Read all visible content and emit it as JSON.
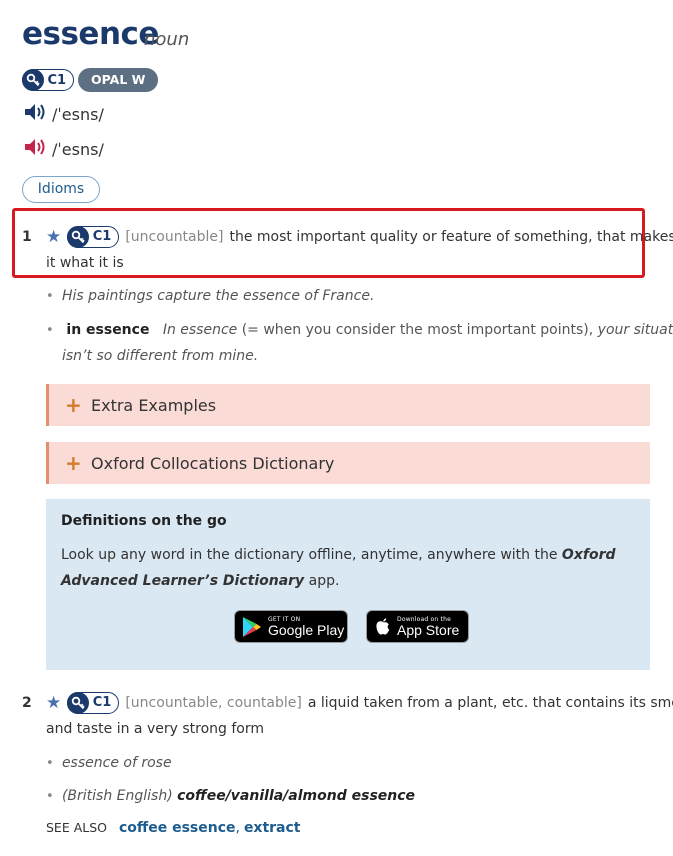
{
  "entry": {
    "headword": "essence",
    "pos": "noun",
    "level": "C1",
    "opal": "OPAL W",
    "pron_uk": "/ˈesns/",
    "pron_us": "/ˈesns/",
    "idioms_label": "Idioms"
  },
  "senses": [
    {
      "number": "1",
      "level": "C1",
      "grammar": "[uncountable]",
      "definition_line1": "the most important quality or feature of something, that makes",
      "definition_line2": "it what it is",
      "examples": [
        {
          "text": "His paintings capture the essence of France."
        }
      ],
      "idiom_example": {
        "phrase": "in essence",
        "lead": "In essence",
        "gloss": "(= when you consider the most important points),",
        "continuation": "your situation",
        "line2": "isn’t so different from mine."
      }
    },
    {
      "number": "2",
      "level": "C1",
      "grammar": "[uncountable, countable]",
      "definition_line1": "a liquid taken from a plant, etc. that contains its smell",
      "definition_line2": "and taste in a very strong form",
      "examples": [
        {
          "text": "essence of rose"
        }
      ],
      "example2": {
        "label": "(British English)",
        "text": "coffee/vanilla/almond essence"
      },
      "see_also": {
        "label": "SEE ALSO",
        "links": [
          "coffee essence",
          "extract"
        ],
        "separator": ","
      }
    }
  ],
  "panels": {
    "extra_examples": "Extra Examples",
    "collocations": "Oxford Collocations Dictionary"
  },
  "promo": {
    "title": "Definitions on the go",
    "text_start": "Look up any word in the dictionary offline, anytime, anywhere with the",
    "app_name": "Oxford Advanced Learner’s Dictionary",
    "text_end": "app.",
    "google_small": "GET IT ON",
    "google_big": "Google Play",
    "apple_small": "Download on the",
    "apple_big": "App Store"
  },
  "colors": {
    "headword": "#1b3a6b",
    "highlight_box": "#d71920",
    "panel_bg": "#fadbd6",
    "promo_bg": "#d9e8f3",
    "link": "#1d5c8f"
  },
  "icons": {
    "level": "oxford-key-icon",
    "audio_uk": "speaker-blue-icon",
    "audio_us": "speaker-red-icon",
    "star": "star-icon",
    "expand": "plus-icon"
  }
}
